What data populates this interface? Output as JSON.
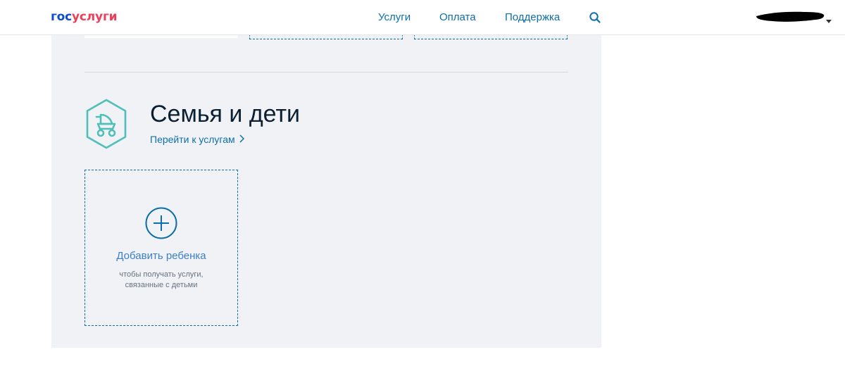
{
  "header": {
    "logo_part1": "гос",
    "logo_part2": "услуги",
    "nav": {
      "services": "Услуги",
      "payment": "Оплата",
      "support": "Поддержка"
    }
  },
  "section": {
    "title": "Семья и дети",
    "link": "Перейти к услугам"
  },
  "add_child_card": {
    "title": "Добавить ребенка",
    "subtitle_line1": "чтобы получать услуги,",
    "subtitle_line2": "связанные с детьми"
  },
  "colors": {
    "brand_blue": "#0d4cd3",
    "brand_red": "#ee3f58",
    "link_blue": "#0d6eab",
    "icon_teal": "#4fbfb8",
    "panel_bg": "#f1f2f5"
  },
  "icons": {
    "search": "search-icon",
    "dropdown": "caret-down-icon",
    "section": "baby-stroller-icon",
    "chevron": "chevron-right-icon",
    "add": "plus-circle-icon"
  }
}
